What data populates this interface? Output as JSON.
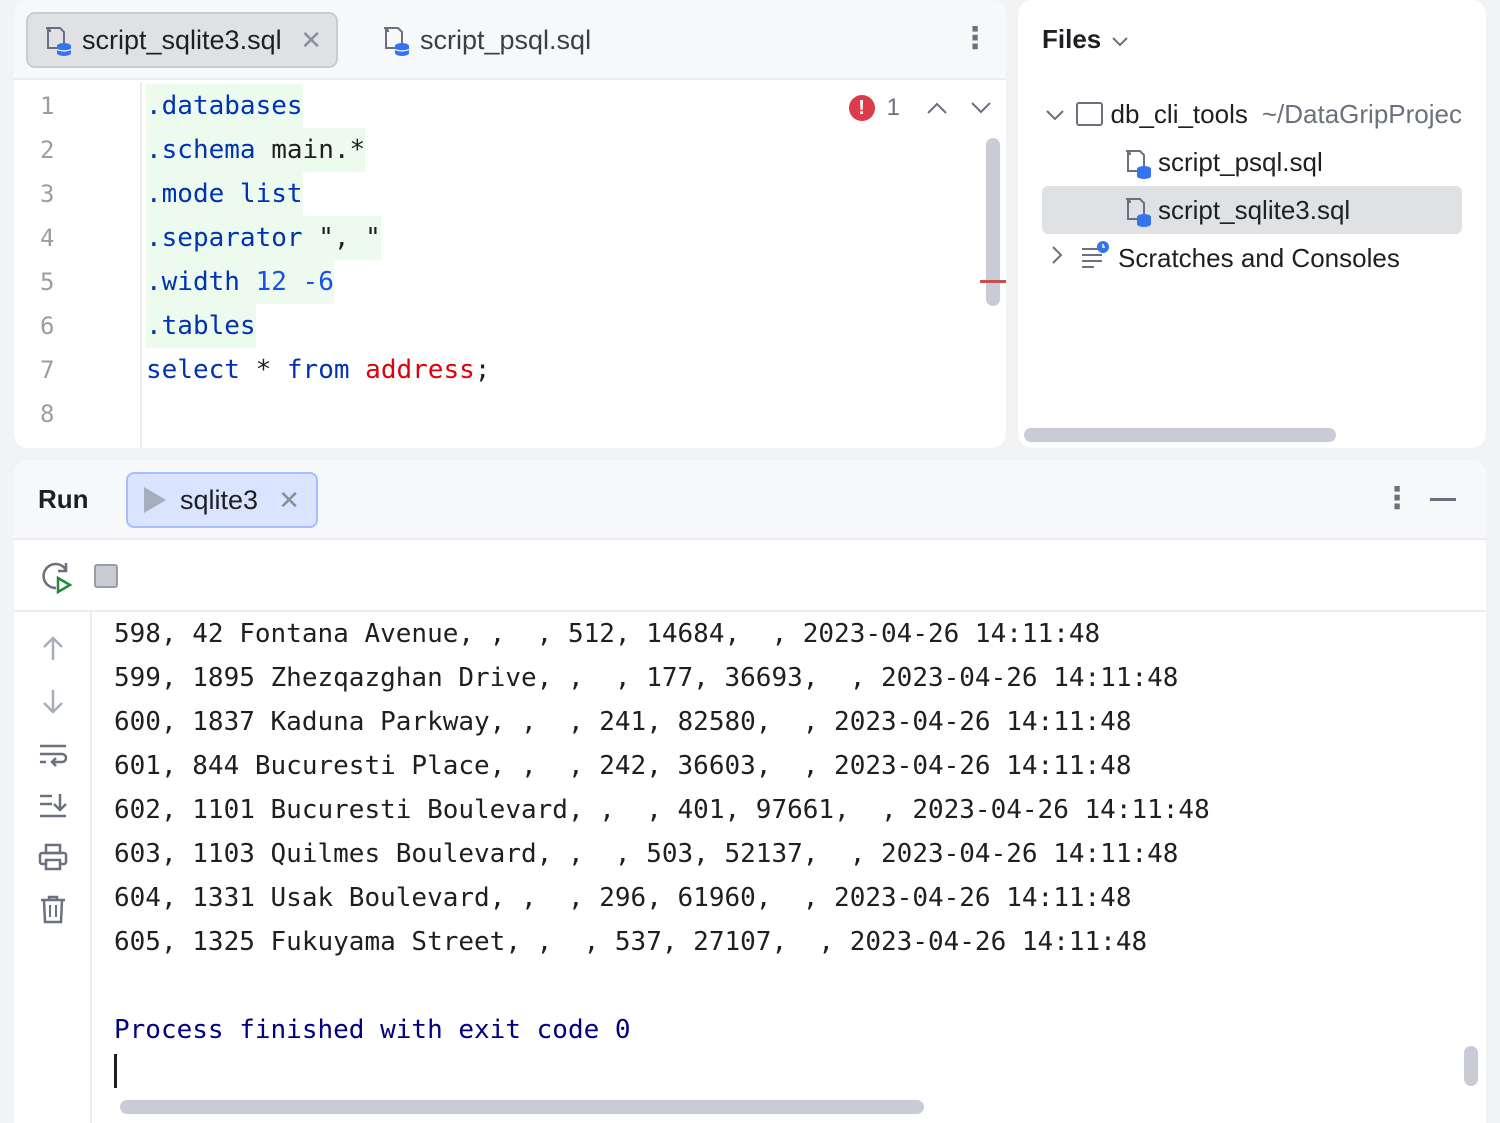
{
  "editor": {
    "tabs": [
      {
        "label": "script_sqlite3.sql",
        "active": true
      },
      {
        "label": "script_psql.sql",
        "active": false
      }
    ],
    "inspection": {
      "error_count": "1"
    },
    "lines": [
      {
        "n": "1"
      },
      {
        "n": "2"
      },
      {
        "n": "3"
      },
      {
        "n": "4"
      },
      {
        "n": "5"
      },
      {
        "n": "6"
      },
      {
        "n": "7"
      },
      {
        "n": "8"
      }
    ],
    "code": {
      "l1": ".databases",
      "l2_kw": ".schema",
      "l2_rest": " main.*",
      "l3": ".mode list",
      "l4_kw": ".separator",
      "l4_rest": " \", \"",
      "l5_kw": ".width",
      "l5_num": " 12 -6",
      "l6": ".tables",
      "l7_kw1": "select",
      "l7_mid": " * ",
      "l7_kw2": "from",
      "l7_sp": " ",
      "l7_tbl": "address",
      "l7_end": ";"
    }
  },
  "files": {
    "title": "Files",
    "tree": [
      {
        "label": "db_cli_tools",
        "hint": "~/DataGripProjec"
      },
      {
        "label": "script_psql.sql"
      },
      {
        "label": "script_sqlite3.sql",
        "selected": true
      },
      {
        "label": "Scratches and Consoles"
      }
    ]
  },
  "run": {
    "title": "Run",
    "tab_label": "sqlite3",
    "output": [
      "598, 42 Fontana Avenue, ,  , 512, 14684,  , 2023-04-26 14:11:48",
      "599, 1895 Zhezqazghan Drive, ,  , 177, 36693,  , 2023-04-26 14:11:48",
      "600, 1837 Kaduna Parkway, ,  , 241, 82580,  , 2023-04-26 14:11:48",
      "601, 844 Bucuresti Place, ,  , 242, 36603,  , 2023-04-26 14:11:48",
      "602, 1101 Bucuresti Boulevard, ,  , 401, 97661,  , 2023-04-26 14:11:48",
      "603, 1103 Quilmes Boulevard, ,  , 503, 52137,  , 2023-04-26 14:11:48",
      "604, 1331 Usak Boulevard, ,  , 296, 61960,  , 2023-04-26 14:11:48",
      "605, 1325 Fukuyama Street, ,  , 537, 27107,  , 2023-04-26 14:11:48"
    ],
    "finished": "Process finished with exit code 0"
  }
}
